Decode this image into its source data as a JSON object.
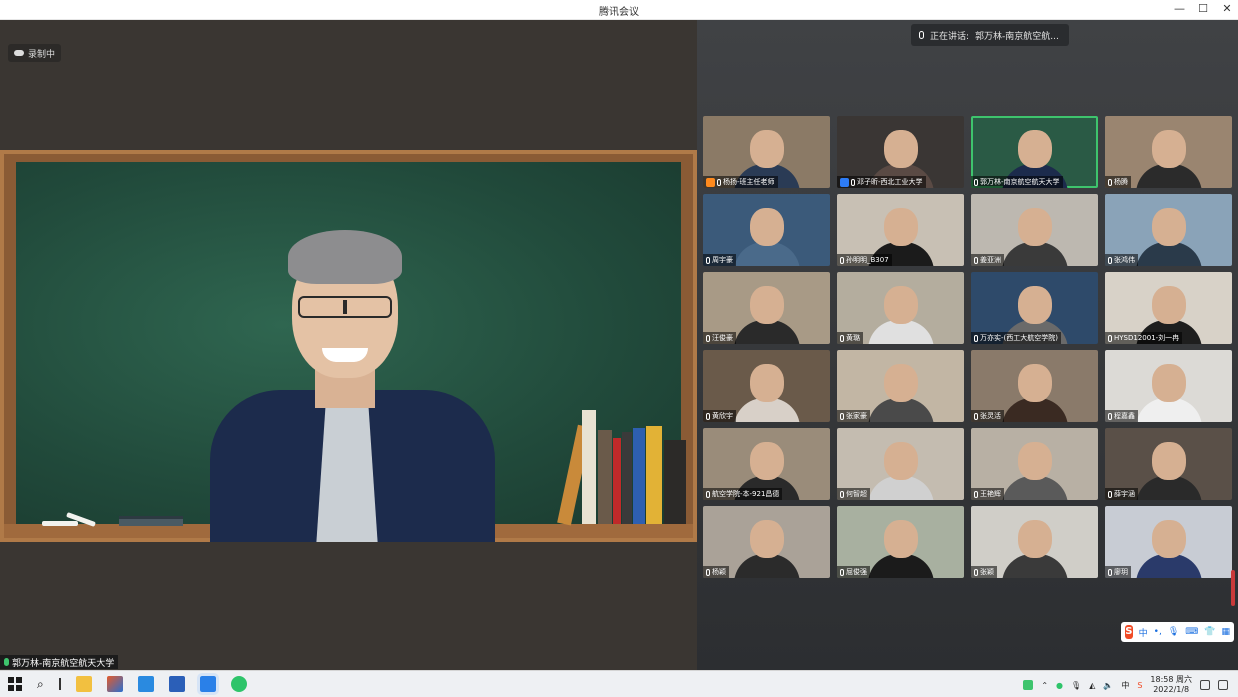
{
  "window": {
    "title": "腾讯会议",
    "minimize": "—",
    "maximize": "☐",
    "close": "✕"
  },
  "recording": {
    "label": "录制中"
  },
  "main_speaker": {
    "label": "郭万林-南京航空航天大学"
  },
  "speaking_now": {
    "prefix": "正在讲话:",
    "name": "郭万林-南京航空航..."
  },
  "tiles": [
    {
      "label": "杨扬-班主任老师",
      "badge": "host",
      "bg": "#8b7a66",
      "shirt": "#2a3b55",
      "active": false
    },
    {
      "label": "邓子昕-西北工业大学",
      "badge": "cohost",
      "bg": "#3a3634",
      "shirt": "#5a4a44",
      "active": false
    },
    {
      "label": "郭万林-南京航空航天大学",
      "badge": "",
      "bg": "#2a5a45",
      "shirt": "#1c2b4c",
      "active": true
    },
    {
      "label": "杨腾",
      "badge": "",
      "bg": "#9a8570",
      "shirt": "#2b2b2b",
      "active": false
    },
    {
      "label": "周宇豪",
      "badge": "",
      "bg": "#3b5a7a",
      "shirt": "#4a6a8a",
      "active": false
    },
    {
      "label": "孙明明_B307",
      "badge": "",
      "bg": "#c8c0b4",
      "shirt": "#1b1b1b",
      "active": false
    },
    {
      "label": "姜亚洲",
      "badge": "",
      "bg": "#bdb8b0",
      "shirt": "#3a3a3a",
      "active": false
    },
    {
      "label": "张鸿伟",
      "badge": "",
      "bg": "#8aa3b8",
      "shirt": "#2a3a4a",
      "active": false
    },
    {
      "label": "汪俊豪",
      "badge": "",
      "bg": "#a89a86",
      "shirt": "#2a2a2a",
      "active": false
    },
    {
      "label": "黄璐",
      "badge": "",
      "bg": "#b4ad9e",
      "shirt": "#e0e0e0",
      "active": false
    },
    {
      "label": "万亦实-(西工大航空学院)",
      "badge": "",
      "bg": "#2e4a6a",
      "shirt": "#6a6a6a",
      "active": false
    },
    {
      "label": "HYSD12001-刘一冉",
      "badge": "",
      "bg": "#d8d2c8",
      "shirt": "#1e1e1e",
      "active": false
    },
    {
      "label": "黄欣宇",
      "badge": "",
      "bg": "#6a5a4a",
      "shirt": "#d8d0c8",
      "active": false
    },
    {
      "label": "张家豪",
      "badge": "",
      "bg": "#c2b6a4",
      "shirt": "#4a4a4a",
      "active": false
    },
    {
      "label": "张灵活",
      "badge": "",
      "bg": "#8a7a6a",
      "shirt": "#3a2a22",
      "active": false
    },
    {
      "label": "程嘉鑫",
      "badge": "",
      "bg": "#dcdad6",
      "shirt": "#efefef",
      "active": false
    },
    {
      "label": "航空学院-本-921昌德",
      "badge": "",
      "bg": "#9a8c7a",
      "shirt": "#2a2a2a",
      "active": false
    },
    {
      "label": "何智超",
      "badge": "",
      "bg": "#c4bcb0",
      "shirt": "#d0d0d0",
      "active": false
    },
    {
      "label": "王艳辉",
      "badge": "",
      "bg": "#b8b0a4",
      "shirt": "#5a5a5a",
      "active": false
    },
    {
      "label": "薛宇涵",
      "badge": "",
      "bg": "#5a5048",
      "shirt": "#2a2a2a",
      "active": false
    },
    {
      "label": "杨颖",
      "badge": "",
      "bg": "#aaa298",
      "shirt": "#2b2b2b",
      "active": false
    },
    {
      "label": "屈俊强",
      "badge": "",
      "bg": "#a8b0a0",
      "shirt": "#1b1b1b",
      "active": false
    },
    {
      "label": "张颖",
      "badge": "",
      "bg": "#d0cec8",
      "shirt": "#3a3a3a",
      "active": false
    },
    {
      "label": "廖玥",
      "badge": "",
      "bg": "#c8ccd4",
      "shirt": "#2a3a6a",
      "active": false
    }
  ],
  "ime": {
    "logo": "S",
    "mode": "中"
  },
  "taskbar": {
    "time": "18:58 周六",
    "date": "2022/1/8"
  }
}
